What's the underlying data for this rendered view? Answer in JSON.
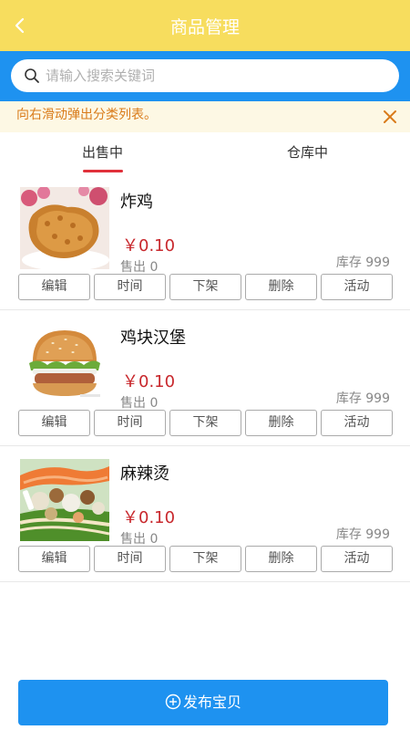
{
  "header": {
    "title": "商品管理",
    "back_icon": "chevron-left-icon"
  },
  "search": {
    "placeholder": "请输入搜索关键词",
    "value": ""
  },
  "notice": {
    "text": "向右滑动弹出分类列表。"
  },
  "tabs": [
    {
      "label": "出售中",
      "active": true
    },
    {
      "label": "仓库中",
      "active": false
    }
  ],
  "products": [
    {
      "name": "炸鸡",
      "price": "￥0.10",
      "sold": "售出 0",
      "stock": "库存 999",
      "image": "fried-chicken-image"
    },
    {
      "name": "鸡块汉堡",
      "price": "￥0.10",
      "sold": "售出 0",
      "stock": "库存 999",
      "image": "burger-image"
    },
    {
      "name": "麻辣烫",
      "price": "￥0.10",
      "sold": "售出 0",
      "stock": "库存 999",
      "image": "malatang-image"
    }
  ],
  "actions": {
    "edit": "编辑",
    "time": "时间",
    "offshelf": "下架",
    "delete": "删除",
    "activity": "活动"
  },
  "publish": {
    "label": "发布宝贝"
  },
  "colors": {
    "header": "#f7dd5e",
    "accent": "#1e92f0",
    "price": "#c8282d",
    "notice_text": "#d97b1a",
    "tab_underline": "#e0303a"
  }
}
